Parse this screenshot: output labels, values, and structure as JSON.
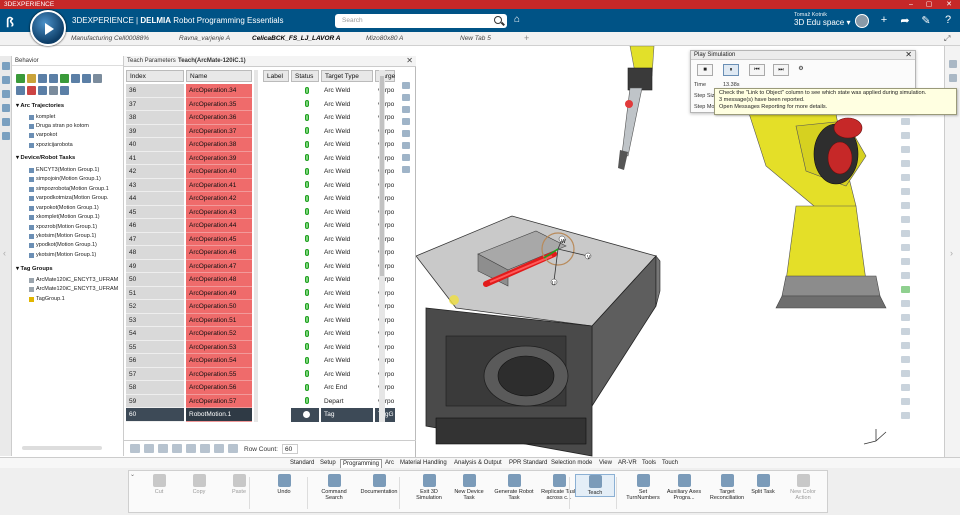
{
  "titlebar": {
    "title": "3DEXPERIENCE",
    "controls": [
      "–",
      "▢",
      "✕"
    ]
  },
  "header": {
    "brand_prefix": "3DEXPERIENCE | ",
    "brand_main": "DELMIA",
    "brand_app": " Robot Programming Essentials",
    "search_placeholder": "Search",
    "user_name": "Tomaž Kotnik",
    "space": "3D Edu space ▾",
    "icons": [
      "tag-icon",
      "add-icon",
      "share-icon",
      "tools-icon",
      "help-icon"
    ],
    "compass_icon": "play-icon",
    "brand_colors": {
      "header": "#005386",
      "titlebar": "#c62828"
    }
  },
  "tabs": [
    {
      "label": "Manufacturing Cell00088%",
      "active": false
    },
    {
      "label": "Ravna_varjenje A",
      "active": false
    },
    {
      "label": "CelicaBCK_FS_LJ_LAVOR A",
      "active": true
    },
    {
      "label": "Mizo80x80 A",
      "active": false
    },
    {
      "label": "New Tab 5",
      "active": false
    }
  ],
  "tab_add": "+",
  "behavior": {
    "title": "Behavior",
    "groups": [
      {
        "label": "Arc Trajectories",
        "items": [
          "komplet",
          "Druga stran po kotom",
          "varpokot",
          "xpozicijarobota"
        ]
      },
      {
        "label": "Device/Robot Tasks",
        "items": [
          "ENCYT3(Motion Group.1)",
          "simpojoin(Motion Group.1)",
          "simpozrobota(Motion Group.1",
          "varpodkotmiza(Motion Group.",
          "varpokot(Motion Group.1)",
          "xkomplet(Motion Group.1)",
          "xpozrob(Motion Group.1)",
          "ykotsim(Motion Group.1)",
          "ypodkot(Motion Group.1)",
          "ykotsim(Motion Group.1)"
        ]
      },
      {
        "label": "Tag Groups",
        "items": [
          "ArcMate120iC_ENCYT3_UFRAM",
          "ArcMate120iC_ENCYT3_UFRAM",
          "TagGroup.1"
        ]
      }
    ]
  },
  "teach": {
    "tabs": [
      "Teach Parameters",
      "Teach(ArcMate-120iC.1)"
    ],
    "columns": {
      "index": "Index",
      "name": "Name",
      "label": "Label",
      "status": "Status",
      "target_type": "Target Type",
      "target": "Targe"
    },
    "rows": [
      {
        "index": "36",
        "name": "ArcOperation.34",
        "type": "Arc Weld",
        "targ": "varpo"
      },
      {
        "index": "37",
        "name": "ArcOperation.35",
        "type": "Arc Weld",
        "targ": "varpo"
      },
      {
        "index": "38",
        "name": "ArcOperation.36",
        "type": "Arc Weld",
        "targ": "varpo"
      },
      {
        "index": "39",
        "name": "ArcOperation.37",
        "type": "Arc Weld",
        "targ": "varpo"
      },
      {
        "index": "40",
        "name": "ArcOperation.38",
        "type": "Arc Weld",
        "targ": "varpo"
      },
      {
        "index": "41",
        "name": "ArcOperation.39",
        "type": "Arc Weld",
        "targ": "varpo"
      },
      {
        "index": "42",
        "name": "ArcOperation.40",
        "type": "Arc Weld",
        "targ": "varpo"
      },
      {
        "index": "43",
        "name": "ArcOperation.41",
        "type": "Arc Weld",
        "targ": "varpo"
      },
      {
        "index": "44",
        "name": "ArcOperation.42",
        "type": "Arc Weld",
        "targ": "varpo"
      },
      {
        "index": "45",
        "name": "ArcOperation.43",
        "type": "Arc Weld",
        "targ": "varpo"
      },
      {
        "index": "46",
        "name": "ArcOperation.44",
        "type": "Arc Weld",
        "targ": "varpo"
      },
      {
        "index": "47",
        "name": "ArcOperation.45",
        "type": "Arc Weld",
        "targ": "varpo"
      },
      {
        "index": "48",
        "name": "ArcOperation.46",
        "type": "Arc Weld",
        "targ": "varpo"
      },
      {
        "index": "49",
        "name": "ArcOperation.47",
        "type": "Arc Weld",
        "targ": "varpo"
      },
      {
        "index": "50",
        "name": "ArcOperation.48",
        "type": "Arc Weld",
        "targ": "varpo"
      },
      {
        "index": "51",
        "name": "ArcOperation.49",
        "type": "Arc Weld",
        "targ": "varpo"
      },
      {
        "index": "52",
        "name": "ArcOperation.50",
        "type": "Arc Weld",
        "targ": "varpo"
      },
      {
        "index": "53",
        "name": "ArcOperation.51",
        "type": "Arc Weld",
        "targ": "varpo"
      },
      {
        "index": "54",
        "name": "ArcOperation.52",
        "type": "Arc Weld",
        "targ": "varpo"
      },
      {
        "index": "55",
        "name": "ArcOperation.53",
        "type": "Arc Weld",
        "targ": "varpo"
      },
      {
        "index": "56",
        "name": "ArcOperation.54",
        "type": "Arc Weld",
        "targ": "varpo"
      },
      {
        "index": "57",
        "name": "ArcOperation.55",
        "type": "Arc Weld",
        "targ": "varpo"
      },
      {
        "index": "58",
        "name": "ArcOperation.56",
        "type": "Arc End",
        "targ": "varpo"
      },
      {
        "index": "59",
        "name": "ArcOperation.57",
        "type": "Depart",
        "targ": "varpo"
      },
      {
        "index": "60",
        "name": "RobotMotion.1",
        "type": "Tag",
        "targ": "TagG",
        "selected": true
      }
    ],
    "row_count_label": "Row Count:",
    "row_count": "60"
  },
  "playsim": {
    "title": "Play Simulation",
    "buttons": [
      "■",
      "⏸",
      "⏮",
      "⏭",
      "⚙"
    ],
    "labels": [
      "Time",
      "Step Size",
      "Step Mode"
    ],
    "time_value": "13.38s"
  },
  "tooltip": {
    "line1": "Check the \"Link to Object\" column to see which state was applied during simulation.",
    "line2": "3 message(s) have been reported.",
    "line3": "Open Messages Reporting for more details."
  },
  "viewport": {
    "manip_labels": {
      "w": "W",
      "v": "V",
      "u": "U"
    }
  },
  "sections": [
    "Standard",
    "Setup",
    "Programming",
    "Arc",
    "Material Handling",
    "Analysis & Output",
    "PPR Standard",
    "Selection mode",
    "View",
    "AR-VR",
    "Tools",
    "Touch"
  ],
  "active_section": "Programming",
  "actions": [
    {
      "label": "Cut",
      "disabled": true
    },
    {
      "label": "Copy",
      "disabled": true
    },
    {
      "label": "Paste",
      "disabled": true
    },
    {
      "label": "Undo",
      "disabled": false
    },
    {
      "label": "Command Search",
      "disabled": false
    },
    {
      "label": "Documentation",
      "disabled": false
    },
    {
      "label": "Exit 3D Simulation",
      "disabled": false
    },
    {
      "label": "New Device Task",
      "disabled": false
    },
    {
      "label": "Generate Robot Task",
      "disabled": false
    },
    {
      "label": "Replicate Task across c...",
      "disabled": false
    },
    {
      "label": "Teach",
      "disabled": false,
      "selected": true
    },
    {
      "label": "Set TurnNumbers",
      "disabled": false
    },
    {
      "label": "Auxiliary Axes Progra...",
      "disabled": false
    },
    {
      "label": "Target Reconciliation",
      "disabled": false
    },
    {
      "label": "Split Task",
      "disabled": false
    },
    {
      "label": "New Color Action",
      "disabled": true
    }
  ]
}
